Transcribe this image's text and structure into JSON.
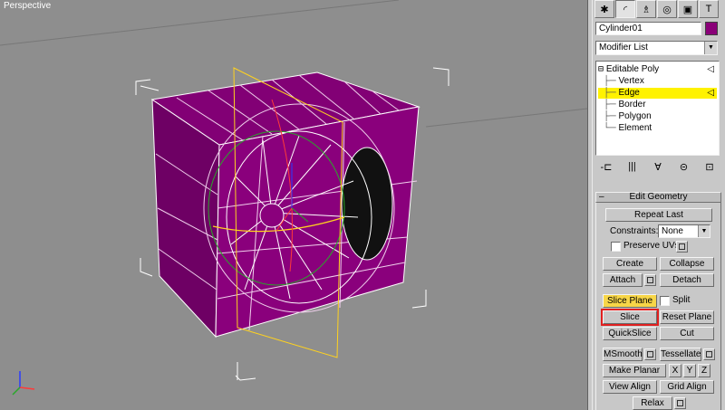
{
  "viewport": {
    "label": "Perspective"
  },
  "tabs": [
    {
      "name": "create-tab",
      "glyph": "✱"
    },
    {
      "name": "modify-tab",
      "glyph": "◜"
    },
    {
      "name": "hierarchy-tab",
      "glyph": "♗"
    },
    {
      "name": "motion-tab",
      "glyph": "◎"
    },
    {
      "name": "display-tab",
      "glyph": "▣"
    },
    {
      "name": "utilities-tab",
      "glyph": "T"
    }
  ],
  "object": {
    "name": "Cylinder01",
    "color": "#8a0078"
  },
  "modifier_list": {
    "label": "Modifier List"
  },
  "stack": {
    "root": "Editable Poly",
    "items": [
      "Vertex",
      "Edge",
      "Border",
      "Polygon",
      "Element"
    ],
    "selected": "Edge"
  },
  "stack_tools": [
    "-⊏",
    "|||",
    "∀",
    "⊝",
    "⊡"
  ],
  "rollout": {
    "title": "Edit Geometry",
    "minus": "–",
    "repeat_last": "Repeat Last",
    "constraints_label": "Constraints:",
    "constraints_value": "None",
    "preserve_uvs": "Preserve UVs",
    "create": "Create",
    "collapse": "Collapse",
    "attach": "Attach",
    "detach": "Detach",
    "slice_plane": "Slice Plane",
    "split": "Split",
    "slice": "Slice",
    "reset_plane": "Reset Plane",
    "quickslice": "QuickSlice",
    "cut": "Cut",
    "msmooth": "MSmooth",
    "tessellate": "Tessellate",
    "make_planar": "Make Planar",
    "x": "X",
    "y": "Y",
    "z": "Z",
    "view_align": "View Align",
    "grid_align": "Grid Align",
    "relax": "Relax"
  }
}
